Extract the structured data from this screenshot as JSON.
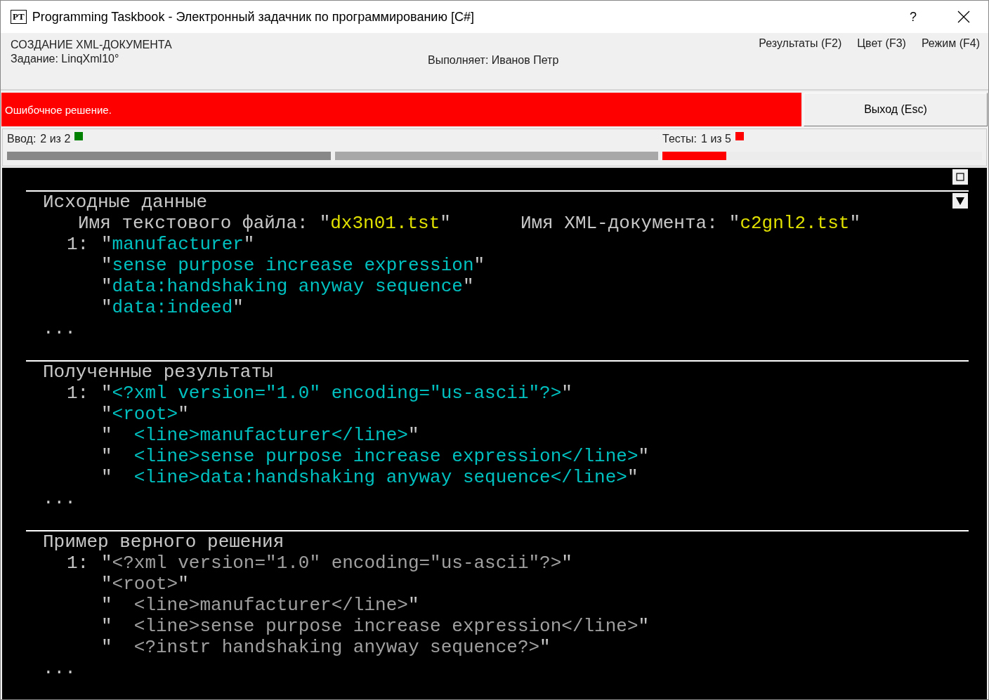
{
  "window": {
    "logo": "PT",
    "title": "Programming Taskbook - Электронный задачник по программированию [C#]",
    "help": "?"
  },
  "header": {
    "group": "СОЗДАНИЕ XML-ДОКУМЕНТА",
    "task": "Задание: LinqXml10°",
    "student": "Выполняет: Иванов Петр",
    "menu": [
      "Результаты (F2)",
      "Цвет (F3)",
      "Режим (F4)"
    ]
  },
  "status": {
    "message": "Ошибочное решение.",
    "color": "#ff0000",
    "exit_button": "Выход (Esc)"
  },
  "input": {
    "label": "Ввод:",
    "count": "2 из 2",
    "color": "#008000"
  },
  "tests": {
    "label": "Тесты:",
    "count": "1 из 5",
    "color": "#ff0000",
    "level": 0.2
  },
  "sections": [
    {
      "kind": "input",
      "title": "Исходные данные",
      "files": [
        {
          "label": "Имя текстового файла:",
          "open": "\"",
          "value": "dx3n01.tst",
          "close": "\""
        },
        {
          "label": "Имя XML-документа:",
          "open": "\"",
          "value": "c2gnl2.tst",
          "close": "\""
        }
      ],
      "lines": [
        {
          "number": "1:",
          "open": "\"",
          "text": "manufacturer",
          "close": "\""
        },
        {
          "open": "\"",
          "text": "sense purpose increase expression",
          "close": "\""
        },
        {
          "open": "\"",
          "text": "data:handshaking anyway sequence",
          "close": "\""
        },
        {
          "open": "\"",
          "text": "data:indeed",
          "close": "\""
        }
      ],
      "more": "..."
    },
    {
      "kind": "output",
      "title": "Полученные результаты",
      "lines": [
        {
          "number": "1:",
          "open": "\"",
          "text": "<?xml version=\"1.0\" encoding=\"us-ascii\"?>",
          "close": "\""
        },
        {
          "open": "\"",
          "text": "<root>",
          "close": "\""
        },
        {
          "open": "\"",
          "text": "  <line>manufacturer</line>",
          "close": "\""
        },
        {
          "open": "\"",
          "text": "  <line>sense purpose increase expression</line>",
          "close": "\""
        },
        {
          "open": "\"",
          "text": "  <line>data:handshaking anyway sequence</line>",
          "close": "\""
        }
      ],
      "more": "..."
    },
    {
      "kind": "sample",
      "title": "Пример верного решения",
      "lines": [
        {
          "number": "1:",
          "open": "\"",
          "text": "<?xml version=\"1.0\" encoding=\"us-ascii\"?>",
          "close": "\""
        },
        {
          "open": "\"",
          "text": "<root>",
          "close": "\""
        },
        {
          "open": "\"",
          "text": "  <line>manufacturer</line>",
          "close": "\""
        },
        {
          "open": "\"",
          "text": "  <line>sense purpose increase expression</line>",
          "close": "\""
        },
        {
          "open": "\"",
          "text": "  <?instr handshaking anyway sequence?>",
          "close": "\""
        }
      ],
      "more": "..."
    }
  ]
}
